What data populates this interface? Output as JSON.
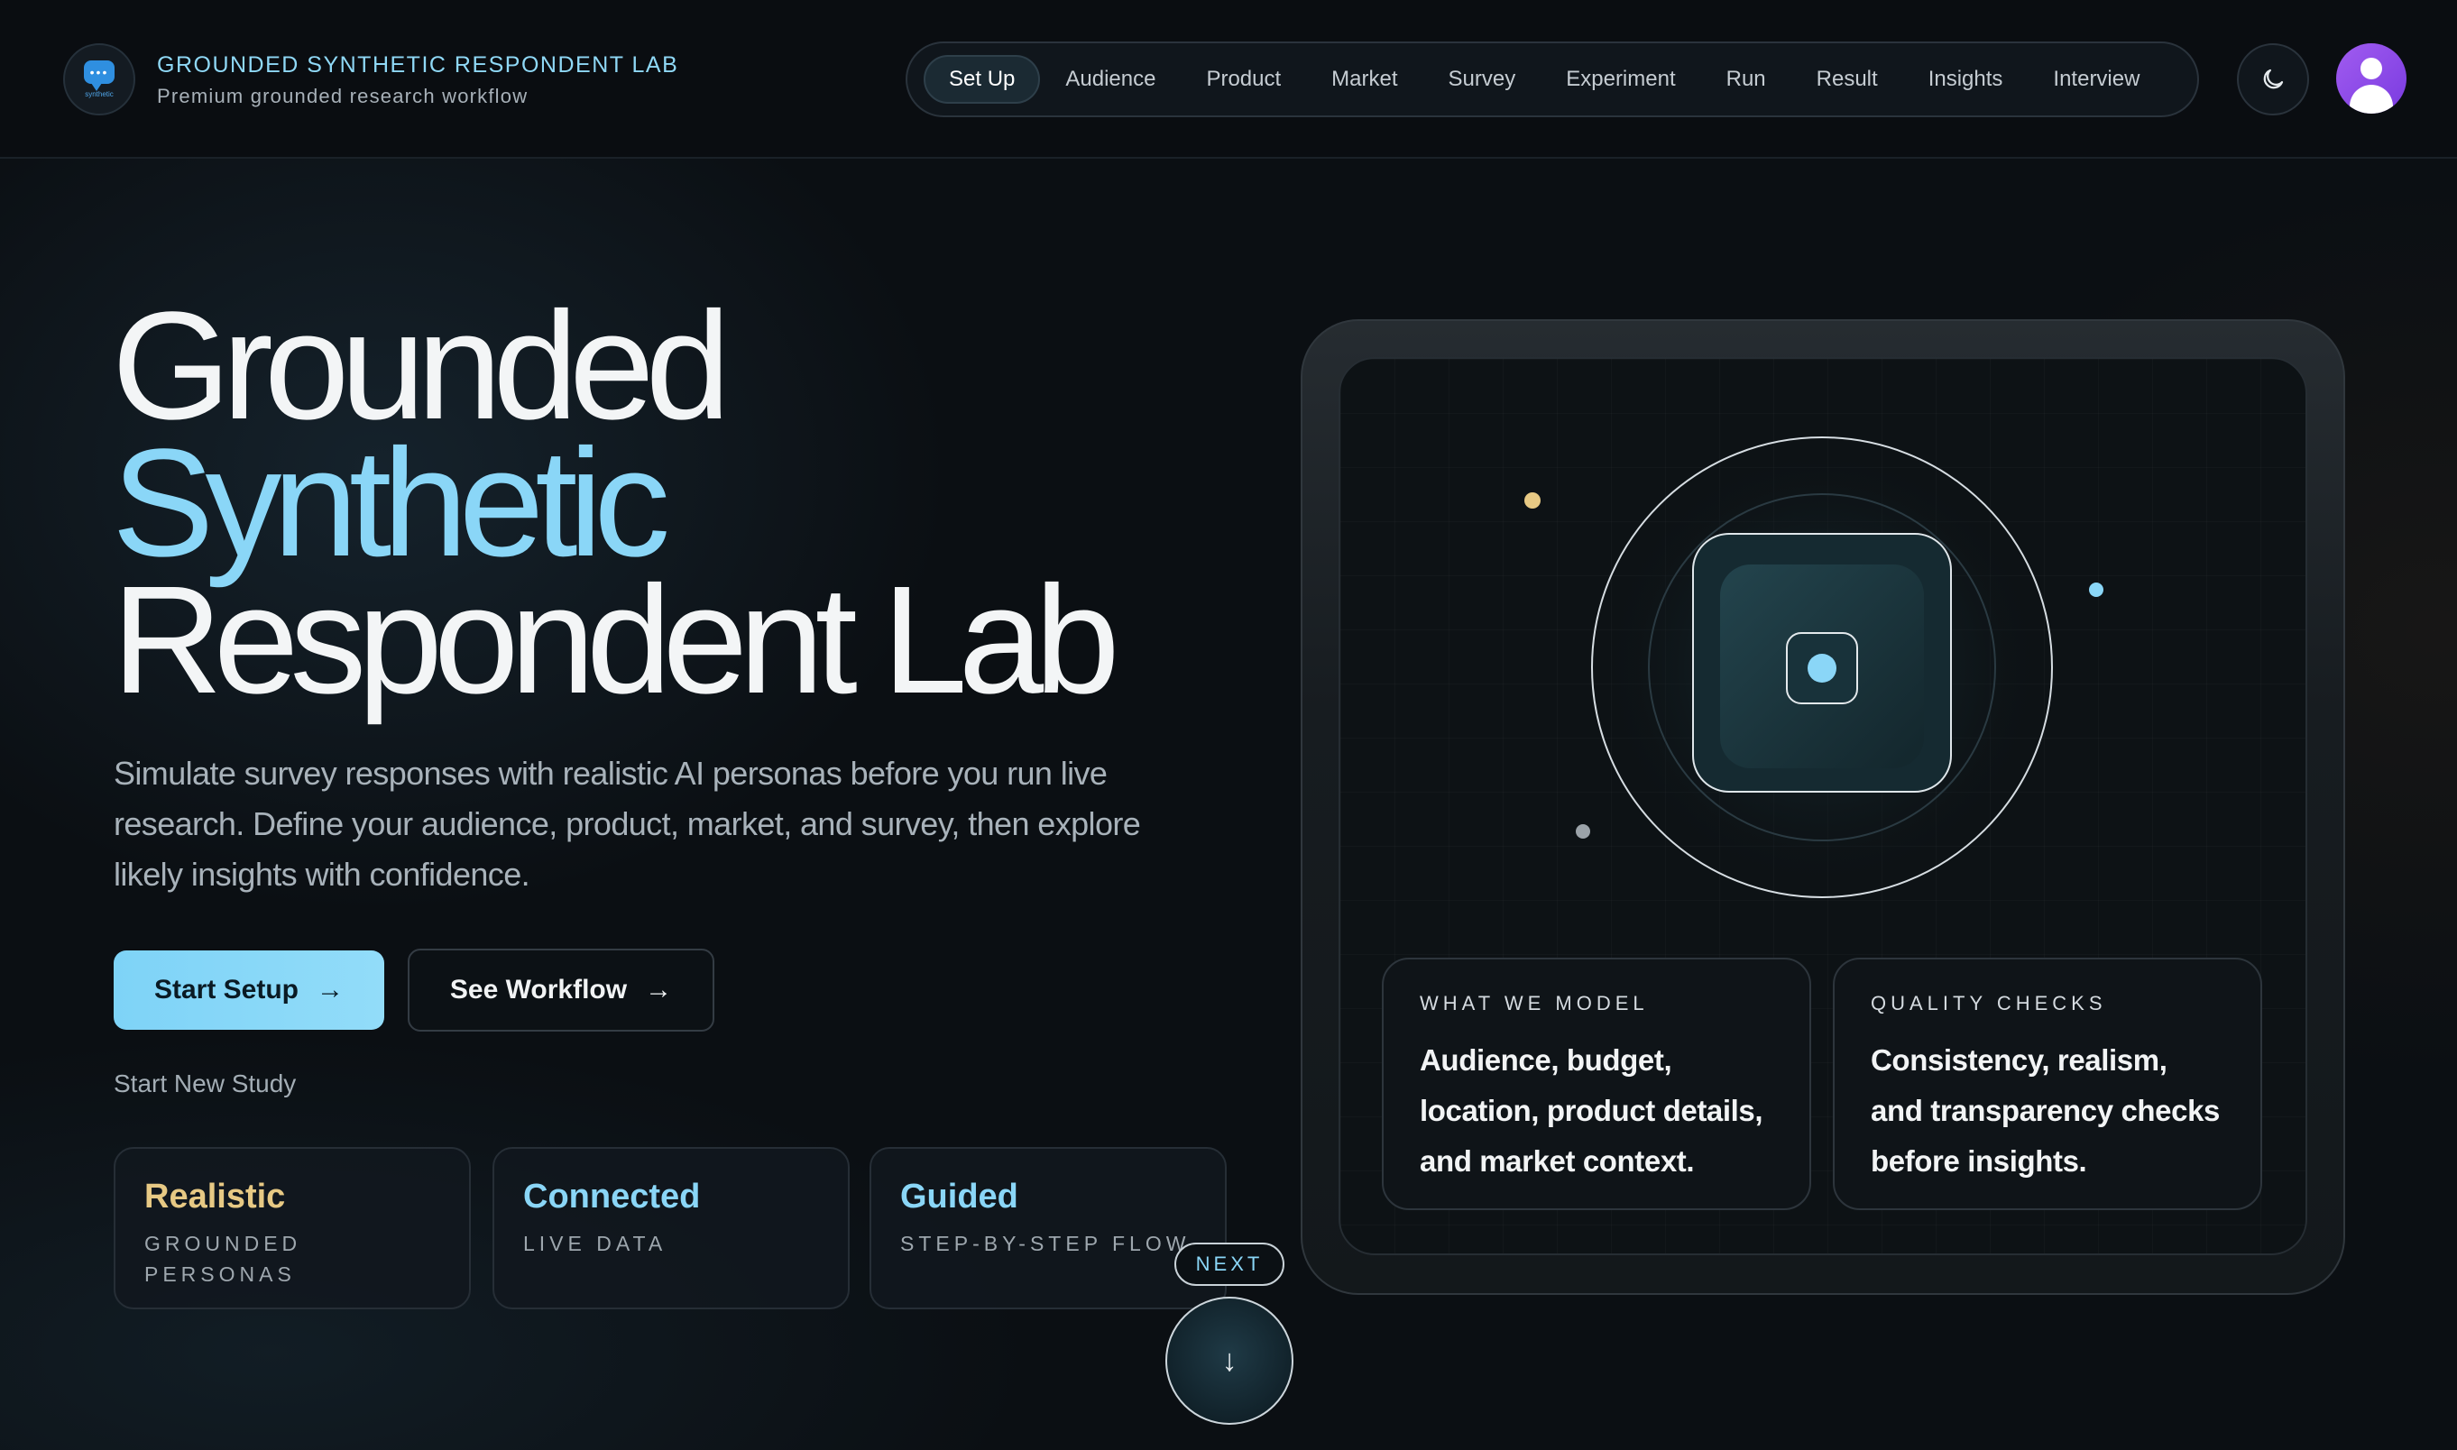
{
  "brand": {
    "logo_text": "synthetic",
    "title": "GROUNDED SYNTHETIC RESPONDENT LAB",
    "subtitle": "Premium grounded research workflow"
  },
  "nav": {
    "tabs": [
      "Set Up",
      "Audience",
      "Product",
      "Market",
      "Survey",
      "Experiment",
      "Run",
      "Result",
      "Insights",
      "Interview"
    ],
    "active_tab": "Set Up",
    "theme_icon": "moon-icon",
    "avatar_icon": "user-icon"
  },
  "hero": {
    "title_line1": "Grounded",
    "title_line2": "Synthetic",
    "title_line3": "Respondent Lab",
    "description": "Simulate survey responses with realistic AI personas before you run live research. Define your audience, product, market, and survey, then explore likely insights with confidence.",
    "primary_button": "Start Setup",
    "secondary_button": "See Workflow",
    "start_new_link": "Start New Study",
    "stats": [
      {
        "title": "Realistic",
        "caption": "GROUNDED PERSONAS"
      },
      {
        "title": "Connected",
        "caption": "LIVE DATA"
      },
      {
        "title": "Guided",
        "caption": "STEP-BY-STEP FLOW"
      }
    ],
    "next_label": "NEXT"
  },
  "panel": {
    "cards": [
      {
        "label": "WHAT WE MODEL",
        "text": "Audience, budget, location, product details, and market context."
      },
      {
        "label": "QUALITY CHECKS",
        "text": "Consistency, realism, and transparency checks before insights."
      }
    ]
  },
  "colors": {
    "accent_blue": "#8ad6f7",
    "accent_gold": "#e7c984",
    "avatar_purple": "#9a54ee",
    "background": "#0b0f13"
  }
}
